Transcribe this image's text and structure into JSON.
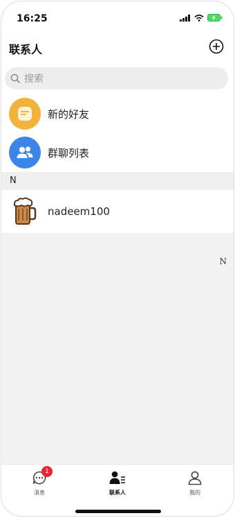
{
  "status": {
    "time": "16:25"
  },
  "header": {
    "title": "联系人",
    "add_icon": "plus-circle-icon"
  },
  "search": {
    "placeholder": "搜索"
  },
  "entries": [
    {
      "label": "新的好友",
      "icon": "message-square-icon",
      "color": "#f2b33d"
    },
    {
      "label": "群聊列表",
      "icon": "group-icon",
      "color": "#3d86e8"
    }
  ],
  "section": {
    "letter": "N"
  },
  "contacts": [
    {
      "name": "nadeem100",
      "avatar": "beer-mug-icon"
    }
  ],
  "index": {
    "letter": "N"
  },
  "tabs": [
    {
      "label": "消息",
      "icon": "chat-icon",
      "badge": "1"
    },
    {
      "label": "联系人",
      "icon": "contacts-icon",
      "active": true
    },
    {
      "label": "我的",
      "icon": "person-icon"
    }
  ]
}
